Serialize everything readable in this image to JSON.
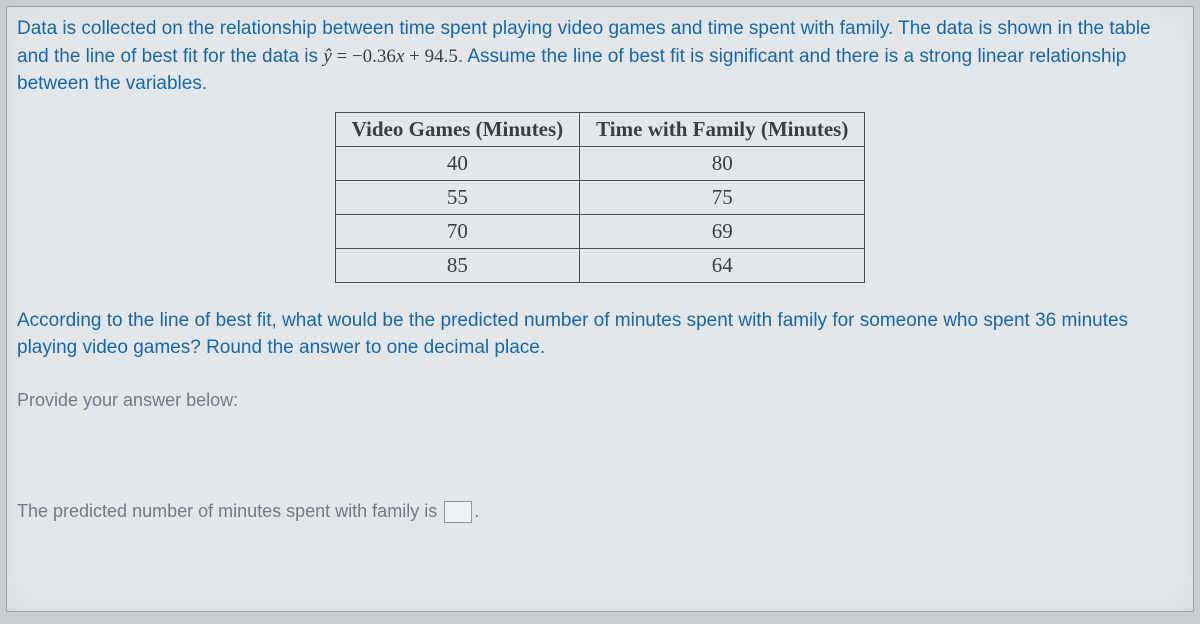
{
  "intro": {
    "part1": "Data is collected on the relationship between time spent playing video games and time spent with family. The data is shown in the table and the line of best fit for the data is ",
    "equation": "ŷ = −0.36x + 94.5",
    "part2": ". Assume the line of best fit is significant and there is a strong linear relationship between the variables."
  },
  "table": {
    "headers": [
      "Video Games (Minutes)",
      "Time with Family (Minutes)"
    ],
    "rows": [
      [
        "40",
        "80"
      ],
      [
        "55",
        "75"
      ],
      [
        "70",
        "69"
      ],
      [
        "85",
        "64"
      ]
    ]
  },
  "question": "According to the line of best fit, what would be the predicted number of minutes spent with family for someone who spent 36 minutes playing video games? Round the answer to one decimal place.",
  "prompt": "Provide your answer below:",
  "answer_prefix": "The predicted number of minutes spent with family is ",
  "answer_suffix": "."
}
